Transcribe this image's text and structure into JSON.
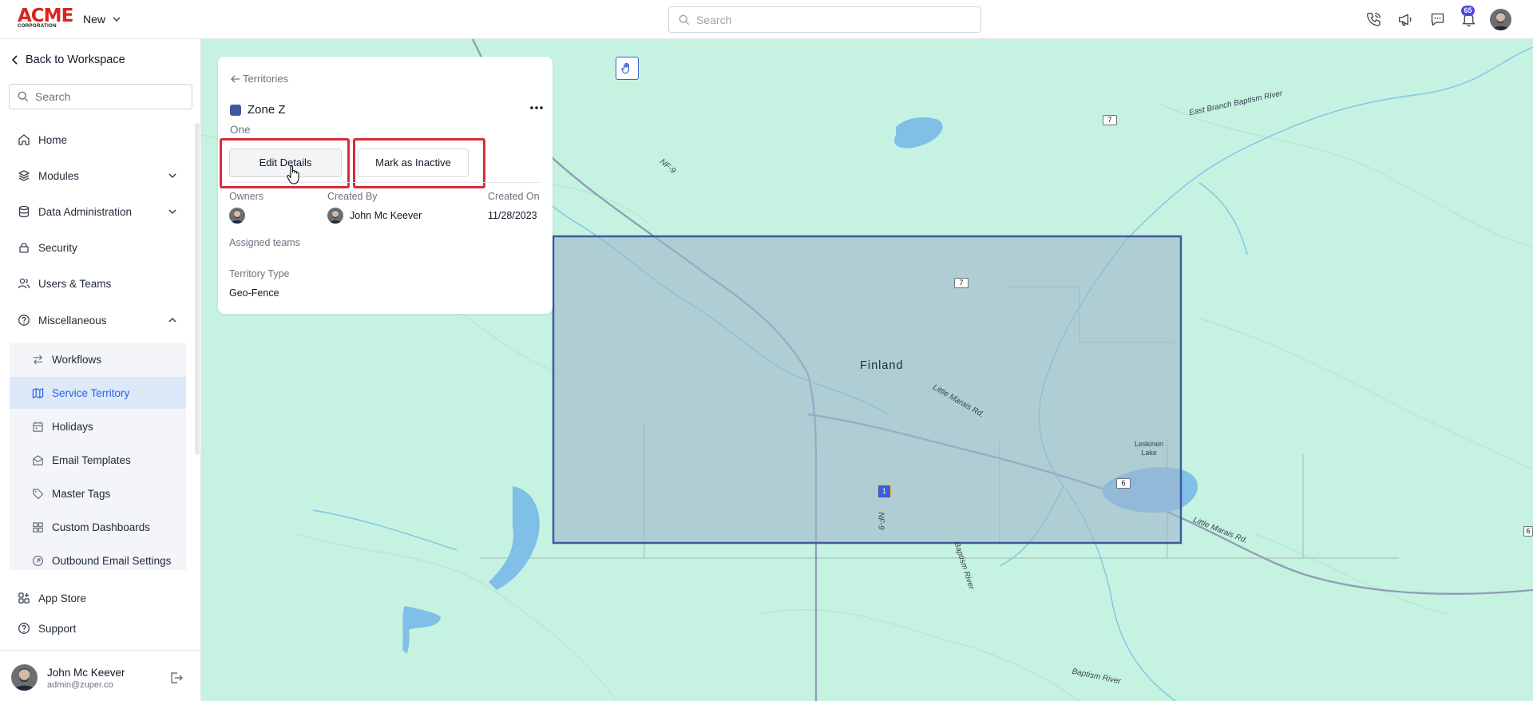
{
  "topbar": {
    "logo_main": "ACME",
    "logo_sub": "CORPORATION",
    "new_label": "New",
    "search_placeholder": "Search",
    "notification_count": "65"
  },
  "sidebar": {
    "back_label": "Back to Workspace",
    "search_placeholder": "Search",
    "items": [
      {
        "label": "Home",
        "icon": "home-icon"
      },
      {
        "label": "Modules",
        "icon": "layers-icon"
      },
      {
        "label": "Data Administration",
        "icon": "database-icon"
      },
      {
        "label": "Security",
        "icon": "lock-icon"
      },
      {
        "label": "Users & Teams",
        "icon": "users-icon"
      },
      {
        "label": "Miscellaneous",
        "icon": "help-circle-icon"
      }
    ],
    "sub_items": [
      {
        "label": "Workflows",
        "icon": "arrows-icon"
      },
      {
        "label": "Service Territory",
        "icon": "map-icon"
      },
      {
        "label": "Holidays",
        "icon": "calendar-icon"
      },
      {
        "label": "Email Templates",
        "icon": "envelope-icon"
      },
      {
        "label": "Master Tags",
        "icon": "tag-icon"
      },
      {
        "label": "Custom Dashboards",
        "icon": "dashboard-icon"
      },
      {
        "label": "Outbound Email Settings",
        "icon": "outbound-email-icon"
      }
    ],
    "bottom_items": [
      {
        "label": "App Store",
        "icon": "grid-icon"
      },
      {
        "label": "Support",
        "icon": "question-icon"
      }
    ],
    "user": {
      "name": "John Mc Keever",
      "email": "admin@zuper.co"
    }
  },
  "territory": {
    "breadcrumb": "Territories",
    "name": "Zone Z",
    "subtitle": "One",
    "swatch_color": "#3b5a9d",
    "edit_label": "Edit Details",
    "inactive_label": "Mark as Inactive",
    "owners_label": "Owners",
    "created_by_label": "Created By",
    "created_by_value": "John Mc Keever",
    "created_on_label": "Created On",
    "created_on_value": "11/28/2023",
    "assigned_teams_label": "Assigned teams",
    "type_label": "Territory Type",
    "type_value": "Geo-Fence"
  },
  "map": {
    "town": "Finland",
    "labels": {
      "east_branch": "East Branch Baptism River",
      "nf9_top": "NF-9",
      "nf9_mid": "NF-9",
      "little_marais_1": "Little Marais Rd.",
      "little_marais_2": "Little Marais Rd.",
      "baptism_river_1": "Baptism River",
      "baptism_river_2": "Baptism River",
      "leskinen": "Leskinen Lake"
    },
    "signs": {
      "s1": "7",
      "s2": "7",
      "s3": "6",
      "s4": "1",
      "s5": "6"
    },
    "accent_color": "#d92c3b"
  }
}
